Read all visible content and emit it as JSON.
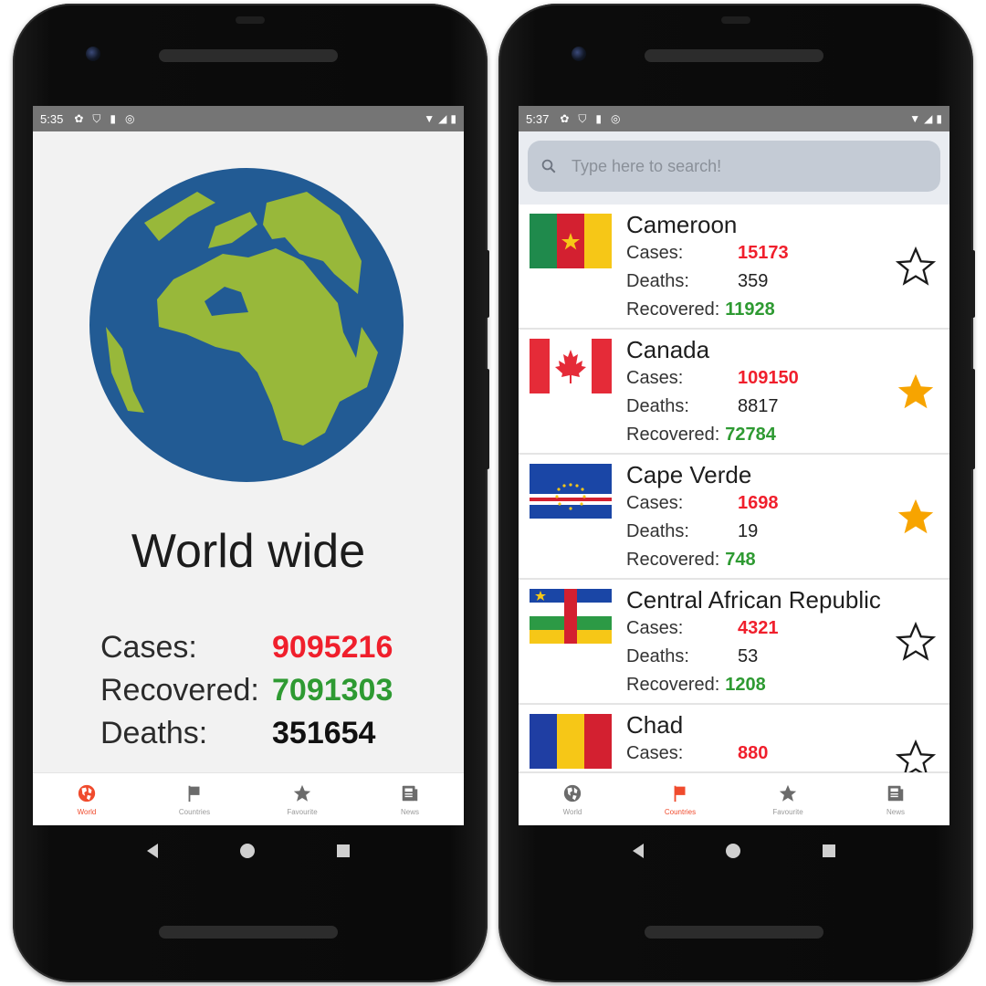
{
  "left_phone": {
    "status": {
      "time": "5:35"
    },
    "title": "World wide",
    "stats": [
      {
        "label": "Cases:",
        "value": "9095216",
        "tone": "red"
      },
      {
        "label": "Recovered:",
        "value": "7091303",
        "tone": "green"
      },
      {
        "label": "Deaths:",
        "value": "351654",
        "tone": "black"
      }
    ],
    "nav": {
      "world": "World",
      "countries": "Countries",
      "favourite": "Favourite",
      "news": "News",
      "active": "world"
    }
  },
  "right_phone": {
    "status": {
      "time": "5:37"
    },
    "search": {
      "placeholder": "Type here to search!"
    },
    "labels": {
      "cases": "Cases:",
      "deaths": "Deaths:",
      "recovered": "Recovered:"
    },
    "countries": [
      {
        "name": "Cameroon",
        "cases": "15173",
        "deaths": "359",
        "recovered": "11928",
        "favourite": false
      },
      {
        "name": "Canada",
        "cases": "109150",
        "deaths": "8817",
        "recovered": "72784",
        "favourite": true
      },
      {
        "name": "Cape Verde",
        "cases": "1698",
        "deaths": "19",
        "recovered": "748",
        "favourite": true
      },
      {
        "name": "Central African Republic",
        "cases": "4321",
        "deaths": "53",
        "recovered": "1208",
        "favourite": false
      },
      {
        "name": "Chad",
        "cases": "880",
        "favourite": false
      }
    ],
    "nav": {
      "world": "World",
      "countries": "Countries",
      "favourite": "Favourite",
      "news": "News",
      "active": "countries"
    }
  },
  "colors": {
    "cases": "#f01f2c",
    "recovered": "#2e9a32",
    "active_nav": "#f04b2d",
    "star_filled": "#f7a400",
    "globe_ocean": "#225b94",
    "globe_land": "#98b83a"
  }
}
